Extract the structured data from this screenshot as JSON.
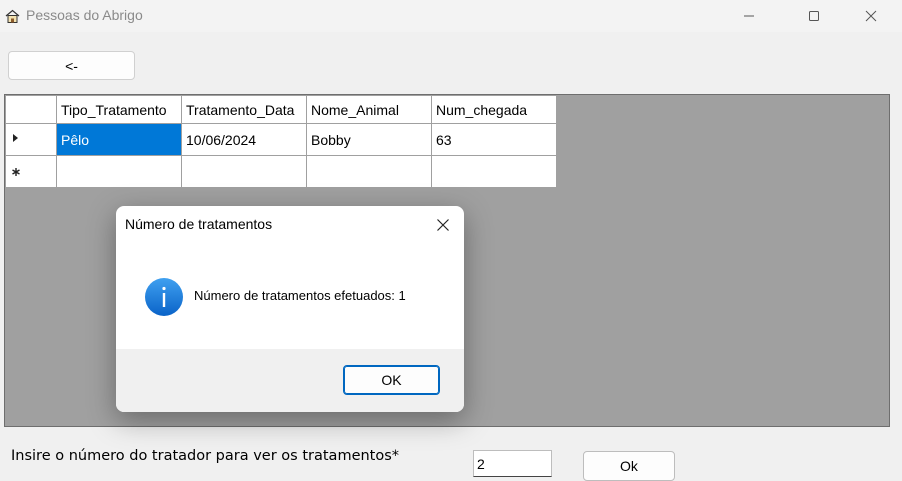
{
  "window": {
    "title": "Pessoas do Abrigo",
    "app_icon": "house-icon",
    "controls": [
      "minimize-icon",
      "maximize-icon",
      "close-icon"
    ]
  },
  "back_button": {
    "label": "<-"
  },
  "grid": {
    "columns": [
      "Tipo_Tratamento",
      "Tratamento_Data",
      "Nome_Animal",
      "Num_chegada"
    ],
    "rows": [
      {
        "indicator": "current-row-arrow-icon",
        "cells": [
          "Pêlo",
          "10/06/2024",
          "Bobby",
          "63"
        ]
      },
      {
        "indicator": "new-row-asterisk-icon",
        "cells": [
          "",
          "",
          "",
          ""
        ]
      }
    ]
  },
  "dialog": {
    "title": "Número de tratamentos",
    "icon": "info-icon",
    "message": "Número de tratamentos efetuados: 1",
    "ok_label": "OK",
    "accent": "#0067c0",
    "icon_color": "#1f7fd8"
  },
  "form": {
    "prompt": "Insire o número do tratador para ver os tratamentos*",
    "input_value": "2",
    "ok_label": "Ok"
  },
  "colors": {
    "selection": "#0078d7",
    "grid_background": "#a0a0a0"
  }
}
